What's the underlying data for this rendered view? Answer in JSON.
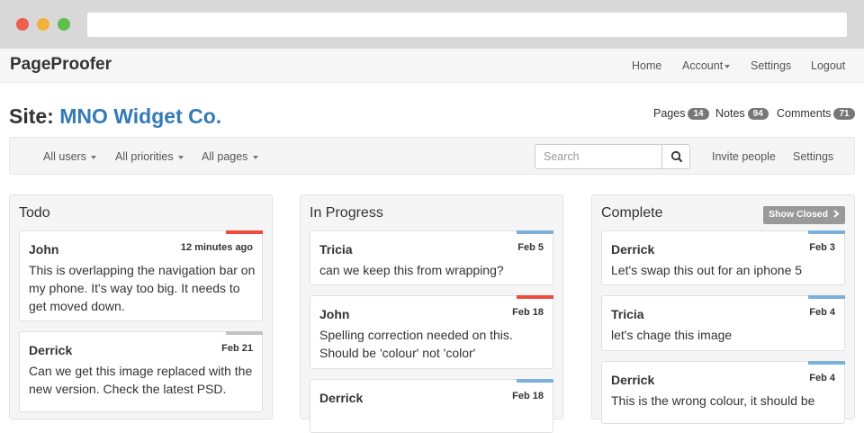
{
  "browser": {
    "url": ""
  },
  "navbar": {
    "brand": "PageProofer",
    "links": {
      "home": "Home",
      "account": "Account",
      "settings": "Settings",
      "logout": "Logout"
    }
  },
  "header": {
    "site_prefix": "Site:",
    "site_name": "MNO Widget Co.",
    "stats": {
      "pages_label": "Pages",
      "pages_count": "14",
      "notes_label": "Notes",
      "notes_count": "94",
      "comments_label": "Comments",
      "comments_count": "71"
    }
  },
  "filters": {
    "users": "All users",
    "priorities": "All priorities",
    "pages": "All pages",
    "search_placeholder": "Search",
    "invite": "Invite people",
    "settings": "Settings"
  },
  "columns": [
    {
      "title": "Todo",
      "cards": [
        {
          "author": "John",
          "time": "12 minutes ago",
          "text": "This is overlapping the navigation bar on my phone. It's way too big. It needs to get moved down.",
          "priority_color": "#f04a3e"
        },
        {
          "author": "Derrick",
          "time": "Feb 21",
          "text": "Can we get this image replaced with the new version. Check the latest PSD.",
          "priority_color": "#c2c2c2"
        }
      ]
    },
    {
      "title": "In Progress",
      "cards": [
        {
          "author": "Tricia",
          "time": "Feb 5",
          "text": "can we keep this from wrapping?",
          "priority_color": "#7ab0dc"
        },
        {
          "author": "John",
          "time": "Feb 18",
          "text": "Spelling correction needed on this. Should be 'colour' not 'color'",
          "priority_color": "#f04a3e"
        },
        {
          "author": "Derrick",
          "time": "Feb 18",
          "text": "",
          "priority_color": "#7ab0dc"
        }
      ]
    },
    {
      "title": "Complete",
      "show_closed": "Show Closed",
      "cards": [
        {
          "author": "Derrick",
          "time": "Feb 3",
          "text": "Let's swap this out for an iphone 5",
          "priority_color": "#7ab0dc"
        },
        {
          "author": "Tricia",
          "time": "Feb 4",
          "text": "let's chage this image",
          "priority_color": "#7ab0dc"
        },
        {
          "author": "Derrick",
          "time": "Feb 4",
          "text": "This is the wrong colour, it should be",
          "priority_color": "#7ab0dc"
        }
      ]
    }
  ],
  "icons": {
    "search": "search-icon",
    "show_closed": "chevron-right-icon"
  }
}
